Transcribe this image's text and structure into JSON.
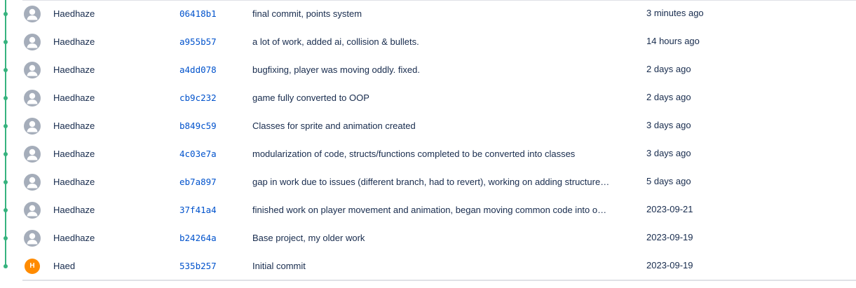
{
  "colors": {
    "graph": "#36b37e",
    "hash_link": "#0052cc",
    "text": "#172b4d",
    "default_avatar": "#a5adba",
    "initial_avatar": "#ff8b00"
  },
  "commits": [
    {
      "author": "Haedhaze",
      "avatar": "default-user-icon",
      "hash": "06418b1",
      "message": "final commit, points system",
      "date": "3 minutes ago"
    },
    {
      "author": "Haedhaze",
      "avatar": "default-user-icon",
      "hash": "a955b57",
      "message": "a lot of work, added ai, collision & bullets.",
      "date": "14 hours ago"
    },
    {
      "author": "Haedhaze",
      "avatar": "default-user-icon",
      "hash": "a4dd078",
      "message": "bugfixing, player was moving oddly. fixed.",
      "date": "2 days ago"
    },
    {
      "author": "Haedhaze",
      "avatar": "default-user-icon",
      "hash": "cb9c232",
      "message": "game fully converted to OOP",
      "date": "2 days ago"
    },
    {
      "author": "Haedhaze",
      "avatar": "default-user-icon",
      "hash": "b849c59",
      "message": "Classes for sprite and animation created",
      "date": "3 days ago"
    },
    {
      "author": "Haedhaze",
      "avatar": "default-user-icon",
      "hash": "4c03e7a",
      "message": "modularization of code, structs/functions completed to be converted into classes",
      "date": "3 days ago"
    },
    {
      "author": "Haedhaze",
      "avatar": "default-user-icon",
      "hash": "eb7a897",
      "message": "gap in work due to issues (different branch, had to revert), working on adding structure…",
      "date": "5 days ago"
    },
    {
      "author": "Haedhaze",
      "avatar": "default-user-icon",
      "hash": "37f41a4",
      "message": "finished work on player movement and animation, began moving common code into o…",
      "date": "2023-09-21"
    },
    {
      "author": "Haedhaze",
      "avatar": "default-user-icon",
      "hash": "b24264a",
      "message": "Base project, my older work",
      "date": "2023-09-19"
    },
    {
      "author": "Haed",
      "avatar_initial": "H",
      "hash": "535b257",
      "message": "Initial commit",
      "date": "2023-09-19"
    }
  ]
}
